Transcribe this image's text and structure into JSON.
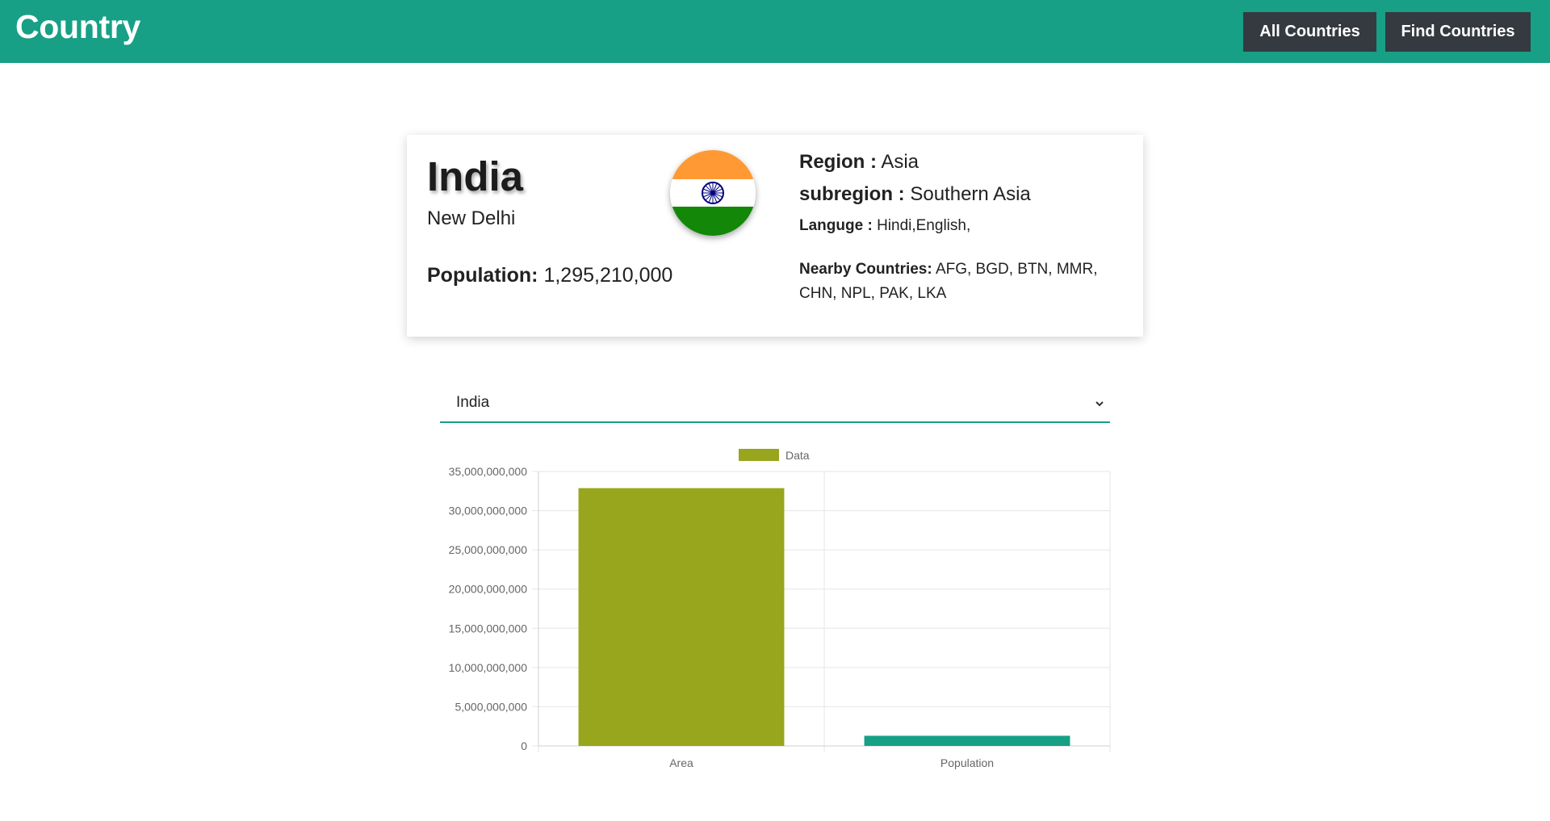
{
  "header": {
    "brand": "Country",
    "nav": {
      "all_countries": "All Countries",
      "find_countries": "Find Countries"
    }
  },
  "country": {
    "name": "India",
    "capital": "New Delhi",
    "population_label": "Population:",
    "population": "1,295,210,000",
    "region_label": "Region :",
    "region": "Asia",
    "subregion_label": "subregion :",
    "subregion": "Southern Asia",
    "language_label": "Languge :",
    "languages": "Hindi,English,",
    "nearby_label": "Nearby Countries:",
    "nearby": "AFG, BGD, BTN, MMR, CHN, NPL, PAK, LKA",
    "flag_icon": "india-flag-icon"
  },
  "selector": {
    "value": "India",
    "icon": "chevron-down-icon"
  },
  "colors": {
    "brand": "#17a086",
    "nav_button": "#343a40",
    "area_bar": "#98a61d",
    "population_bar": "#17a086"
  },
  "chart_data": {
    "type": "bar",
    "categories": [
      "Area",
      "Population"
    ],
    "series": [
      {
        "name": "Data",
        "values": [
          32872000000,
          1295210000
        ]
      }
    ],
    "bar_colors": [
      "#98a61d",
      "#17a086"
    ],
    "ylim": [
      0,
      35000000000
    ],
    "yticks": [
      0,
      5000000000,
      10000000000,
      15000000000,
      20000000000,
      25000000000,
      30000000000,
      35000000000
    ],
    "ytick_labels": [
      "0",
      "5,000,000,000",
      "10,000,000,000",
      "15,000,000,000",
      "20,000,000,000",
      "25,000,000,000",
      "30,000,000,000",
      "35,000,000,000"
    ],
    "legend": "top",
    "grid": true
  }
}
